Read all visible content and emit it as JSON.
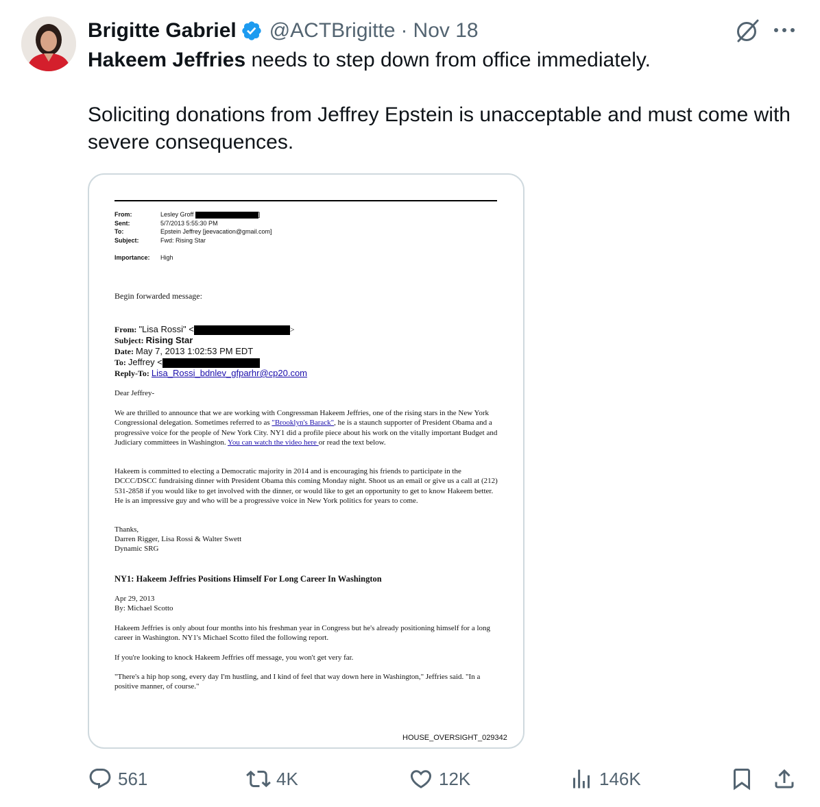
{
  "tweet": {
    "author_name": "Brigitte Gabriel",
    "handle": "@ACTBrigitte",
    "separator": "·",
    "date": "Nov 18",
    "text_mention": "Hakeem Jeffries",
    "text_line1_rest": " needs to step down from office immediately.",
    "text_para2": "Soliciting donations from Jeffrey Epstein is unacceptable and must come with severe consequences."
  },
  "document": {
    "header": {
      "from_label": "From:",
      "from_value": "Lesley Groff",
      "sent_label": "Sent:",
      "sent_value": "5/7/2013 5:55:30 PM",
      "to_label": "To:",
      "to_value": "Epstein Jeffrey [jeevacation@gmail.com]",
      "subject_label": "Subject:",
      "subject_value": "Fwd: Rising Star",
      "importance_label": "Importance:",
      "importance_value": "High"
    },
    "begin_forwarded": "Begin forwarded message:",
    "fwd": {
      "from_label": "From:",
      "from_value": "\"Lisa Rossi\" <",
      "subject_label": "Subject:",
      "subject_value": "Rising Star",
      "date_label": "Date:",
      "date_value": "May 7, 2013 1:02:53 PM EDT",
      "to_label": "To:",
      "to_value": "Jeffrey <",
      "replyto_label": "Reply-To:",
      "replyto_value": "Lisa_Rossi_bdnlev_gfparhr@cp20.com"
    },
    "greeting": "Dear Jeffrey-",
    "para1_a": "We are thrilled to announce that we are working with Congressman Hakeem Jeffries, one of the rising stars in the New York Congressional delegation. Sometimes referred to as ",
    "para1_link1": "\"Brooklyn's Barack\"",
    "para1_b": ", he is a staunch supporter of President Obama and a progressive voice for the people of New York City. NY1 did a profile piece about his work on the vitally important Budget and Judiciary committees in Washington. ",
    "para1_link2": "You can watch the video here ",
    "para1_c": "or read the text below.",
    "para2": "Hakeem is committed to electing a Democratic majority in 2014 and is encouraging his friends to participate in the DCCC/DSCC fundraising dinner with President Obama this coming Monday night. Shoot us an email or give us a call at (212) 531-2858 if you would like to get involved with the dinner, or would like to get an opportunity to get to know Hakeem better. He is an impressive guy and who will be a progressive voice in New York politics for years to come.",
    "thanks": "Thanks,",
    "signers": "Darren Rigger, Lisa Rossi & Walter Swett",
    "company": "Dynamic SRG",
    "article_title": "NY1: Hakeem Jeffries Positions Himself For Long Career In Washington",
    "article_date": "Apr 29, 2013",
    "article_byline": "By: Michael Scotto",
    "article_p1": "Hakeem Jeffries is only about four months into his freshman year in Congress but he's already positioning himself for a long career in Washington. NY1's Michael Scotto filed the following report.",
    "article_p2": "If you're looking to knock Hakeem Jeffries off message, you won't get very far.",
    "article_p3": "\"There's a hip hop song, every day I'm hustling, and I kind of feel that way down here in Washington,\" Jeffries said. \"In a positive manner, of course.\"",
    "footer_id": "HOUSE_OVERSIGHT_029342"
  },
  "actions": {
    "replies": "561",
    "reposts": "4K",
    "likes": "12K",
    "views": "146K"
  },
  "colors": {
    "text": "#0f1419",
    "secondary": "#536471",
    "verified": "#1d9bf0",
    "card_border": "#cfd9de",
    "doc_link": "#1a0dab"
  },
  "icons": {
    "verified": "verified-badge-icon",
    "grok": "grok-icon",
    "more": "more-icon",
    "reply": "reply-icon",
    "repost": "repost-icon",
    "like": "like-icon",
    "views": "views-icon",
    "bookmark": "bookmark-icon",
    "share": "share-icon"
  }
}
